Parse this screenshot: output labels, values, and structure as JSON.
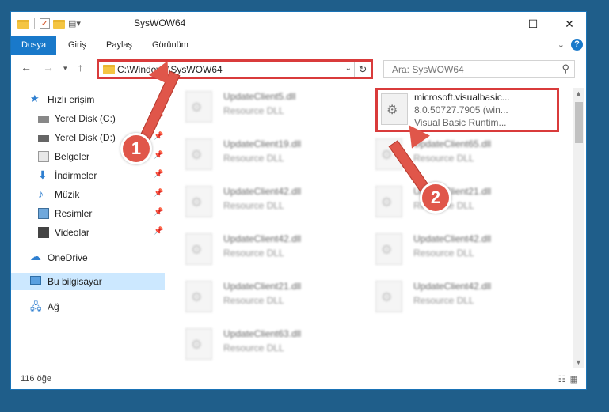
{
  "title": "SysWOW64",
  "tabs": [
    "Dosya",
    "Giriş",
    "Paylaş",
    "Görünüm"
  ],
  "address": "C:\\Windows\\SysWOW64",
  "search_placeholder": "Ara: SysWOW64",
  "nav": [
    {
      "label": "Hızlı erişim",
      "icon": "star-icon"
    },
    {
      "label": "Yerel Disk (C:)",
      "icon": "drive-icon",
      "pinned": true
    },
    {
      "label": "Yerel Disk (D:)",
      "icon": "drive-icon",
      "pinned": true
    },
    {
      "label": "Belgeler",
      "icon": "documents-icon",
      "pinned": true
    },
    {
      "label": "İndirmeler",
      "icon": "download-icon",
      "pinned": true
    },
    {
      "label": "Müzik",
      "icon": "music-icon",
      "pinned": true
    },
    {
      "label": "Resimler",
      "icon": "pictures-icon",
      "pinned": true
    },
    {
      "label": "Videolar",
      "icon": "video-icon",
      "pinned": true
    },
    {
      "label": "OneDrive",
      "icon": "cloud-icon"
    },
    {
      "label": "Bu bilgisayar",
      "icon": "computer-icon",
      "selected": true
    },
    {
      "label": "Ağ",
      "icon": "network-icon"
    }
  ],
  "files_left": [
    {
      "name": "UpdateClient5.dll",
      "type": "Resource DLL"
    },
    {
      "name": "UpdateClient19.dll",
      "type": "Resource DLL"
    },
    {
      "name": "UpdateClient42.dll",
      "type": "Resource DLL"
    },
    {
      "name": "UpdateClient42.dll",
      "type": "Resource DLL"
    },
    {
      "name": "UpdateClient21.dll",
      "type": "Resource DLL"
    },
    {
      "name": "UpdateClient63.dll",
      "type": "Resource DLL"
    }
  ],
  "files_right": [
    {
      "name": "UpdateClient65.dll",
      "type": "Resource DLL"
    },
    {
      "name": "UpdateClient21.dll",
      "type": "Resource DLL"
    },
    {
      "name": "UpdateClient42.dll",
      "type": "Resource DLL"
    },
    {
      "name": "UpdateClient42.dll",
      "type": "Resource DLL"
    }
  ],
  "highlighted_file": {
    "name": "microsoft.visualbasic...",
    "version": "8.0.50727.7905 (win...",
    "description": "Visual Basic Runtim..."
  },
  "status": "116 öğe",
  "badges": [
    "1",
    "2"
  ],
  "colors": {
    "accent": "#1979ca",
    "annotation": "#e0564a",
    "highlight_border": "#d93b3b"
  }
}
